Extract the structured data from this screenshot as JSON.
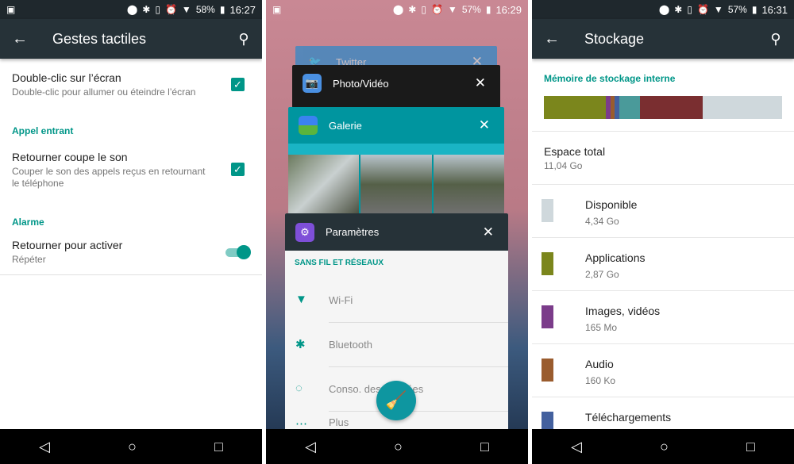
{
  "panel1": {
    "status": {
      "battery": "58%",
      "time": "16:27"
    },
    "title": "Gestes tactiles",
    "items": [
      {
        "title": "Double-clic sur l’écran",
        "subtitle": "Double-clic pour allumer ou éteindre l’écran",
        "checked": true
      }
    ],
    "sections": [
      {
        "header": "Appel entrant",
        "title": "Retourner coupe le son",
        "subtitle": "Couper le son des appels reçus en retournant le téléphone",
        "checked": true
      },
      {
        "header": "Alarme",
        "title": "Retourner pour activer",
        "subtitle": "Répéter",
        "toggle_on": true
      }
    ]
  },
  "panel2": {
    "status": {
      "battery": "57%",
      "time": "16:29"
    },
    "cards": [
      {
        "title": "Twitter",
        "color": "#3b88c3"
      },
      {
        "title": "Photo/Vidéo",
        "color": "#1a1a1a"
      },
      {
        "title": "Galerie",
        "color": "#00959f"
      },
      {
        "title": "Paramètres",
        "color": "#263238"
      }
    ],
    "settings": {
      "section": "SANS FIL ET RÉSEAUX",
      "items": [
        "Wi-Fi",
        "Bluetooth",
        "Conso. des données",
        "Plus"
      ]
    }
  },
  "panel3": {
    "status": {
      "battery": "57%",
      "time": "16:31"
    },
    "title": "Stockage",
    "section": "Mémoire de stockage interne",
    "bar": [
      {
        "color": "#7b861c",
        "percent": 26
      },
      {
        "color": "#7b3c8a",
        "percent": 2
      },
      {
        "color": "#9a5c2e",
        "percent": 1.7
      },
      {
        "color": "#43609e",
        "percent": 2
      },
      {
        "color": "#4a9a9a",
        "percent": 8.7
      },
      {
        "color": "#7a2e30",
        "percent": 26.3
      },
      {
        "color": "#cfd8dc",
        "percent": 33.3
      }
    ],
    "total": {
      "label": "Espace total",
      "value": "11,04 Go"
    },
    "rows": [
      {
        "label": "Disponible",
        "value": "4,34 Go",
        "color": "#cfd8dc"
      },
      {
        "label": "Applications",
        "value": "2,87 Go",
        "color": "#7b861c"
      },
      {
        "label": "Images, vidéos",
        "value": "165 Mo",
        "color": "#7b3c8a"
      },
      {
        "label": "Audio",
        "value": "160 Ko",
        "color": "#9a5c2e"
      },
      {
        "label": "Téléchargements",
        "value": "",
        "color": "#43609e"
      }
    ]
  }
}
